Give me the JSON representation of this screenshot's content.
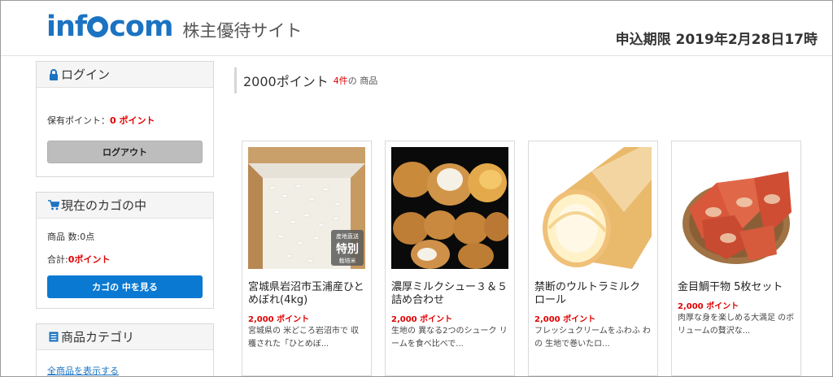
{
  "header": {
    "logo_text": "infocom",
    "site_name": "株主優待サイト",
    "deadline": "申込期限 2019年2月28日17時"
  },
  "sidebar": {
    "login": {
      "title": "ログイン",
      "icon": "lock-icon",
      "points_label": "保有ポイント：",
      "points_value": "0 ポイント",
      "logout_label": "ログアウト"
    },
    "cart": {
      "title": "現在のカゴの中",
      "icon": "cart-icon",
      "count_label": "商品 数:0点",
      "total_label": "合計:",
      "total_value": "0ポイント",
      "view_label": "カゴの 中を見る"
    },
    "category": {
      "title": "商品カテゴリ",
      "icon": "list-icon",
      "all_link": "全商品を表示する"
    }
  },
  "main": {
    "title": "2000ポイント",
    "count": "4件",
    "count_suffix": "の 商品",
    "products": [
      {
        "name": "宮城県岩沼市玉浦産ひとめぼれ(4kg)",
        "price": "2,000 ポイント",
        "desc": "宮城県の 米どころ岩沼市で 収穫された「ひとめぼ...",
        "badge_top": "産地直送",
        "badge_mid": "特別",
        "badge_bot": "栽培米"
      },
      {
        "name": "濃厚ミルクシュー３＆５ 詰め合わせ",
        "price": "2,000 ポイント",
        "desc": "生地の 異なる2つのシューク リームを食べ比べで..."
      },
      {
        "name": "禁断のウルトラミルク ロール",
        "price": "2,000 ポイント",
        "desc": "フレッシュクリームをふわふ わの 生地で巻いたロ..."
      },
      {
        "name": "金目鯛干物 5枚セット",
        "price": "2,000 ポイント",
        "desc": "肉厚な身を楽しめる大満足 のボリュームの贅沢な..."
      }
    ]
  },
  "colors": {
    "brand": "#1b73c2",
    "accent_red": "#e00000",
    "button_blue": "#0a79d2"
  }
}
